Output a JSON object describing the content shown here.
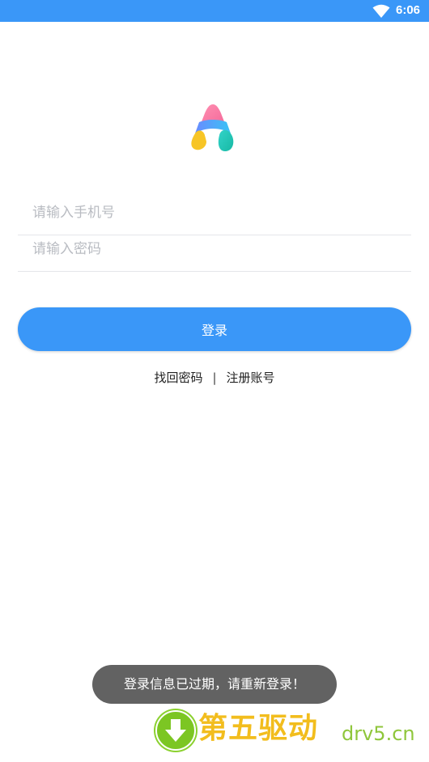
{
  "status_bar": {
    "time": "6:06",
    "wifi_icon": "wifi-icon",
    "color": "#3a97f8"
  },
  "logo": {
    "icon": "app-logo-icon"
  },
  "form": {
    "phone_placeholder": "请输入手机号",
    "phone_value": "",
    "password_placeholder": "请输入密码",
    "password_value": "",
    "login_label": "登录"
  },
  "links": {
    "forgot_password": "找回密码",
    "separator": "|",
    "register": "注册账号"
  },
  "toast": {
    "message": "登录信息已过期，请重新登录！"
  },
  "watermark": {
    "cn": "第五驱动",
    "en": "drv5.cn",
    "icon": "download-arrow-icon"
  },
  "colors": {
    "accent": "#3a97f8",
    "toast_bg": "#626262"
  }
}
